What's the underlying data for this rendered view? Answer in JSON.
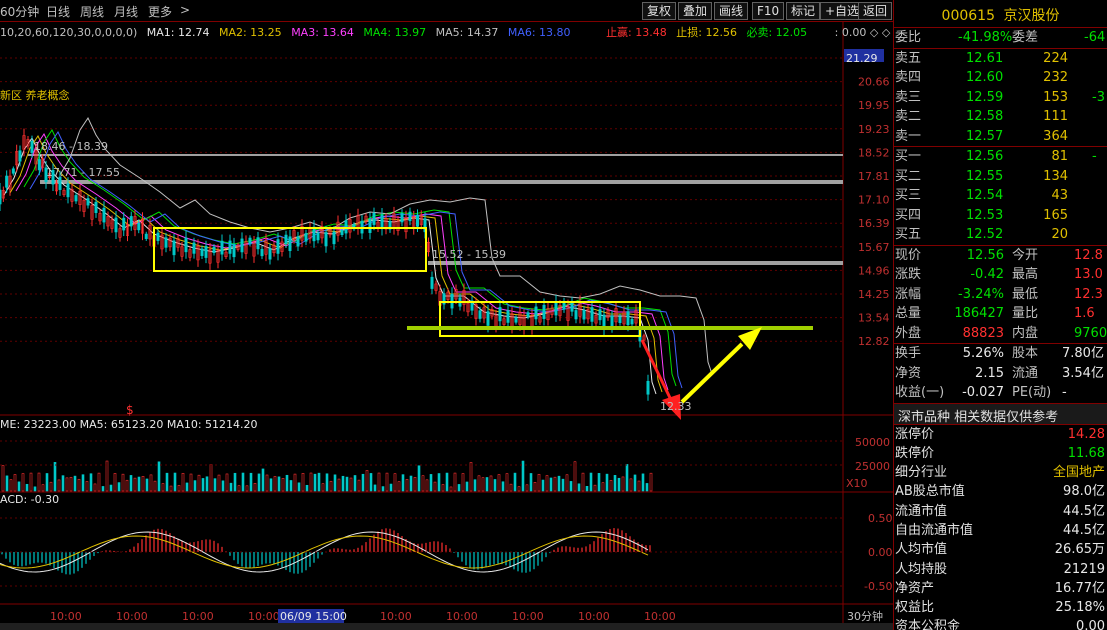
{
  "toolbar": {
    "items": [
      "60分钟",
      "日线",
      "周线",
      "月线",
      "更多",
      ">"
    ],
    "buttons": [
      "复权",
      "叠加",
      "画线",
      "F10",
      "标记",
      "+自选",
      "返回"
    ]
  },
  "ma_line": {
    "params": "10,20,60,120,30,0,0,0,0)",
    "ma1": "MA1: 12.74",
    "ma2": "MA2: 13.25",
    "ma3": "MA3: 13.64",
    "ma4": "MA4: 13.97",
    "ma5": "MA5: 14.37",
    "ma6": "MA6: 13.80",
    "take_profit": "止赢: 13.48",
    "stop_loss": "止损: 12.56",
    "must_sell": "必卖: 12.05",
    "extra": ": 0.00 ◇ ◇"
  },
  "concept": "新区  养老概念",
  "price_axis": [
    "21.29",
    "20.66",
    "19.95",
    "19.23",
    "18.52",
    "17.81",
    "17.10",
    "16.39",
    "15.67",
    "14.96",
    "14.25",
    "13.54",
    "12.82"
  ],
  "annotations": {
    "range1": "18.46 - 18.39",
    "range2": "17.71 - 17.55",
    "range3": "15.52 - 15.39",
    "low": "12.33"
  },
  "volume_line": "ME: 23223.00  MA5: 65123.20  MA10: 51214.20",
  "volume_axis": [
    "50000",
    "25000",
    "X10"
  ],
  "macd_line": "ACD: -0.30",
  "macd_axis": [
    "0.50",
    "0.00",
    "-0.50"
  ],
  "time_axis": [
    "10:00",
    "10:00",
    "10:00",
    "10:00",
    "06/09 15:00",
    "10:00",
    "10:00",
    "10:00",
    "10:00",
    "10:00"
  ],
  "period_label": "30分钟",
  "stock": {
    "code": "000615",
    "name": "京汉股份"
  },
  "order_ratio": {
    "label": "委比",
    "value": "-41.98%",
    "label2": "委差",
    "value2": "-64"
  },
  "sell_orders": [
    {
      "label": "卖五",
      "price": "12.61",
      "vol": "224"
    },
    {
      "label": "卖四",
      "price": "12.60",
      "vol": "232"
    },
    {
      "label": "卖三",
      "price": "12.59",
      "vol": "153",
      "extra": "-3"
    },
    {
      "label": "卖二",
      "price": "12.58",
      "vol": "111"
    },
    {
      "label": "卖一",
      "price": "12.57",
      "vol": "364"
    }
  ],
  "buy_orders": [
    {
      "label": "买一",
      "price": "12.56",
      "vol": "81",
      "extra": "-"
    },
    {
      "label": "买二",
      "price": "12.55",
      "vol": "134"
    },
    {
      "label": "买三",
      "price": "12.54",
      "vol": "43"
    },
    {
      "label": "买四",
      "price": "12.53",
      "vol": "165"
    },
    {
      "label": "买五",
      "price": "12.52",
      "vol": "20"
    }
  ],
  "quote": [
    {
      "k1": "现价",
      "v1": "12.56",
      "k2": "今开",
      "v2": "12.8"
    },
    {
      "k1": "涨跌",
      "v1": "-0.42",
      "k2": "最高",
      "v2": "13.0"
    },
    {
      "k1": "涨幅",
      "v1": "-3.24%",
      "k2": "最低",
      "v2": "12.3"
    },
    {
      "k1": "总量",
      "v1": "186427",
      "k2": "量比",
      "v2": "1.6"
    },
    {
      "k1": "外盘",
      "v1": "88823",
      "k2": "内盘",
      "v2": "9760"
    }
  ],
  "fundamentals": [
    {
      "k1": "换手",
      "v1": "5.26%",
      "k2": "股本",
      "v2": "7.80亿"
    },
    {
      "k1": "净资",
      "v1": "2.15",
      "k2": "流通",
      "v2": "3.54亿"
    },
    {
      "k1": "收益(一)",
      "v1": "-0.027",
      "k2": "PE(动)",
      "v2": "-"
    }
  ],
  "notice": "深市品种  相关数据仅供参考",
  "details": [
    {
      "k": "涨停价",
      "v": "14.28"
    },
    {
      "k": "跌停价",
      "v": "11.68"
    },
    {
      "k": "细分行业",
      "v": "全国地产"
    },
    {
      "k": "AB股总市值",
      "v": "98.0亿"
    },
    {
      "k": "流通市值",
      "v": "44.5亿"
    },
    {
      "k": "自由流通市值",
      "v": "44.5亿"
    },
    {
      "k": "人均市值",
      "v": "26.65万"
    },
    {
      "k": "人均持股",
      "v": "21219"
    },
    {
      "k": "净资产",
      "v": "16.77亿"
    },
    {
      "k": "权益比",
      "v": "25.18%"
    },
    {
      "k": "资本公积金",
      "v": "0.00"
    }
  ],
  "colors": {
    "ma1": "#e8e8e8",
    "ma2": "#e0c000",
    "ma3": "#ff40ff",
    "ma4": "#00e000",
    "ma5": "#c0c0c0",
    "ma6": "#4060ff",
    "box": "#ffff00",
    "support": "#a0d000",
    "down_arrow": "#ff2020",
    "up_arrow": "#ffff00"
  }
}
